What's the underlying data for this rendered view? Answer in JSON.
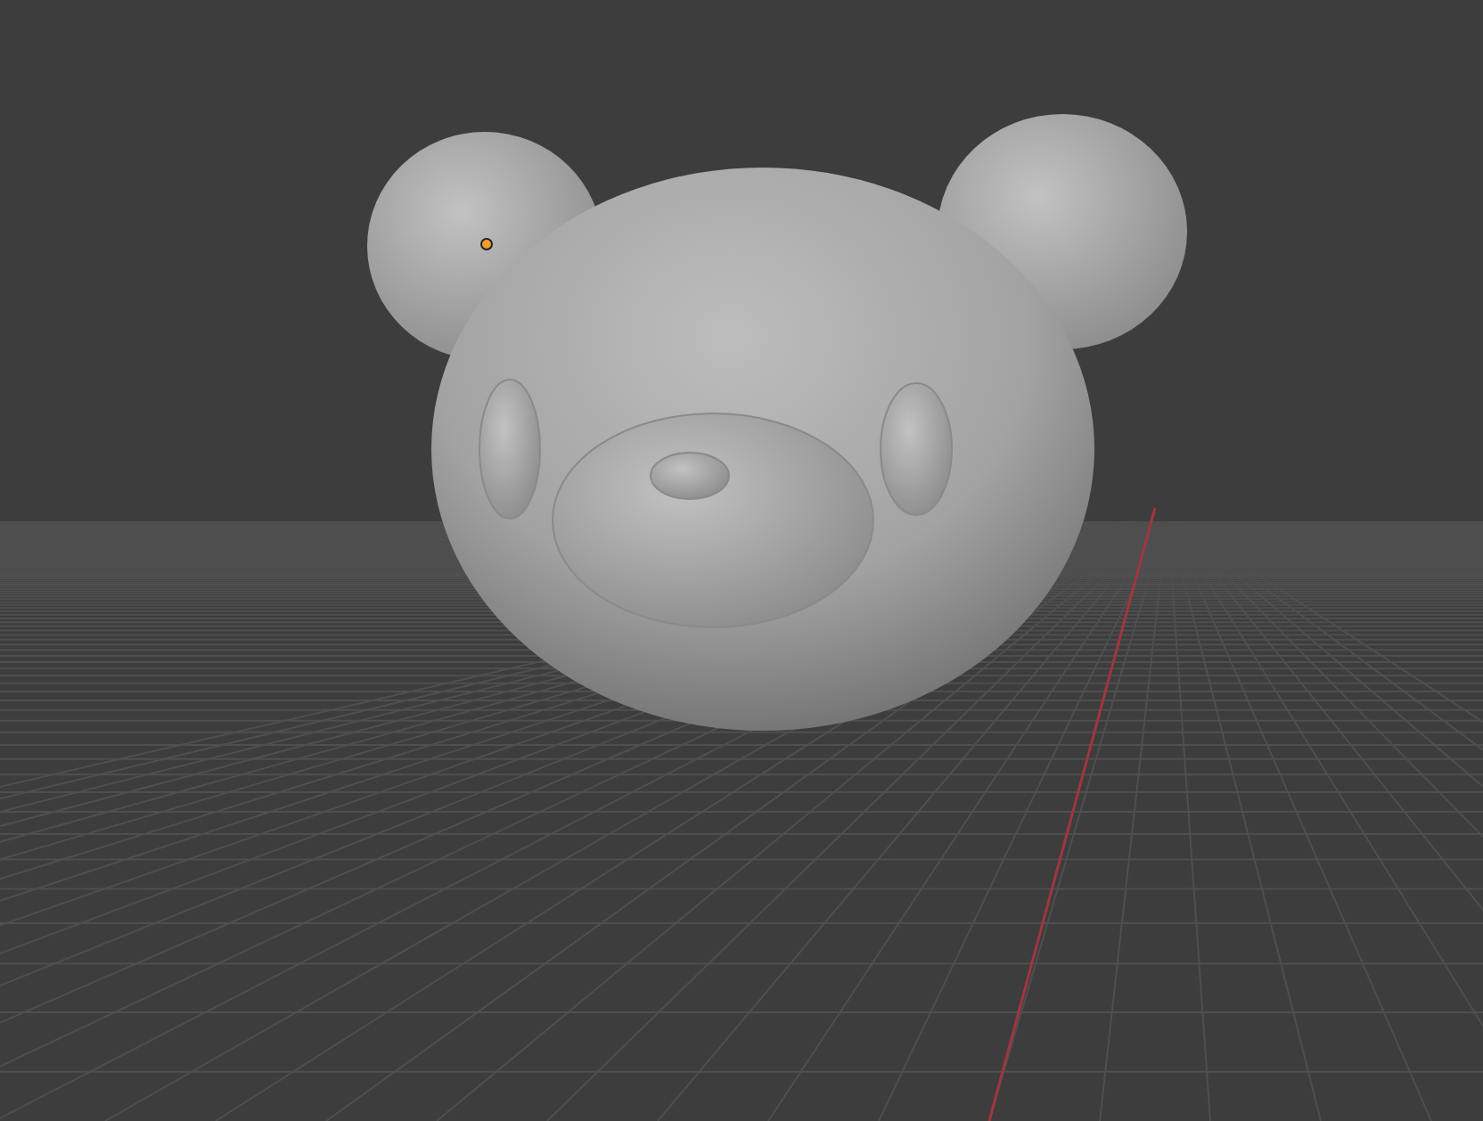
{
  "viewport": {
    "grid": true,
    "x_axis": true,
    "origin_marker": true
  }
}
